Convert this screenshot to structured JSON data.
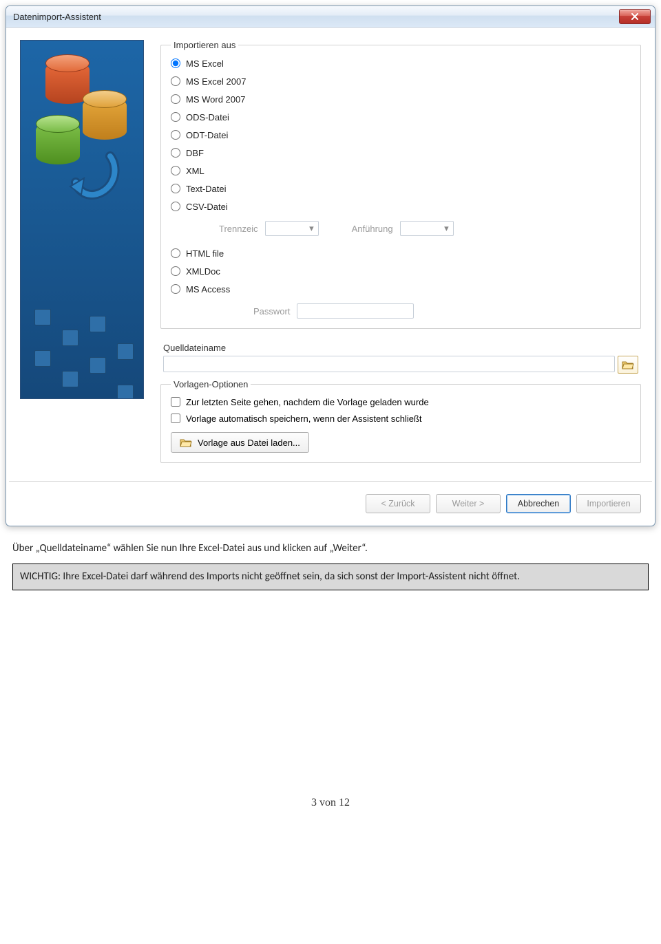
{
  "window": {
    "title": "Datenimport-Assistent"
  },
  "importFrom": {
    "legend": "Importieren aus",
    "options": [
      {
        "label": "MS Excel",
        "selected": true
      },
      {
        "label": "MS Excel 2007",
        "selected": false
      },
      {
        "label": "MS Word 2007",
        "selected": false
      },
      {
        "label": "ODS-Datei",
        "selected": false
      },
      {
        "label": "ODT-Datei",
        "selected": false
      },
      {
        "label": "DBF",
        "selected": false
      },
      {
        "label": "XML",
        "selected": false
      },
      {
        "label": "Text-Datei",
        "selected": false
      },
      {
        "label": "CSV-Datei",
        "selected": false
      }
    ],
    "csv": {
      "separator_label": "Trennzeic",
      "quote_label": "Anführung"
    },
    "options2": [
      {
        "label": "HTML file",
        "selected": false
      },
      {
        "label": "XMLDoc",
        "selected": false
      },
      {
        "label": "MS Access",
        "selected": false
      }
    ],
    "password_label": "Passwort"
  },
  "sourceFile": {
    "label": "Quelldateiname",
    "value": ""
  },
  "templates": {
    "legend": "Vorlagen-Optionen",
    "checks": [
      "Zur letzten Seite gehen, nachdem die Vorlage geladen wurde",
      "Vorlage automatisch speichern, wenn der Assistent schließt"
    ],
    "load_button": "Vorlage aus Datei laden..."
  },
  "buttons": {
    "back": "< Zurück",
    "next": "Weiter >",
    "cancel": "Abbrechen",
    "import": "Importieren"
  },
  "doc": {
    "note1": "Über „Quelldateiname“ wählen Sie nun Ihre Excel-Datei aus und klicken auf „Weiter“.",
    "note2": "WICHTIG: Ihre Excel-Datei darf während des Imports nicht geöffnet sein, da sich sonst der Import-Assistent nicht öffnet.",
    "page": "3 von 12"
  }
}
